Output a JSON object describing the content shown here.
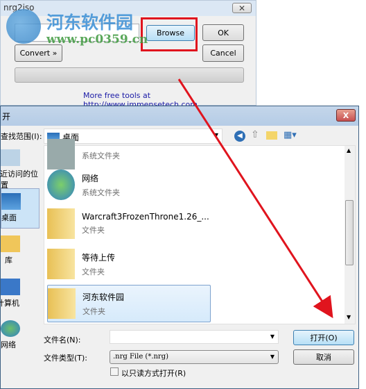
{
  "app": {
    "title": "nrg2iso",
    "browse": "Browse",
    "ok": "OK",
    "convert": "Convert »",
    "cancel": "Cancel",
    "progress": 0,
    "link": "More free tools at http://www.immensetech.com"
  },
  "watermark": {
    "name": "河东软件园",
    "url": "www.pc0359.cn"
  },
  "dialog": {
    "title": "开",
    "close": "X",
    "look_in_label": "查找范围(I):",
    "look_in_value": "桌面",
    "sidebar": [
      {
        "label": "最近访问的位置"
      },
      {
        "label": "桌面"
      },
      {
        "label": "库"
      },
      {
        "label": "计算机"
      },
      {
        "label": "网络"
      }
    ],
    "items": [
      {
        "name": "",
        "type": "系统文件夹",
        "icon": "computer-icon"
      },
      {
        "name": "网络",
        "type": "系统文件夹",
        "icon": "network-icon"
      },
      {
        "name": "Warcraft3FrozenThrone1.26_...",
        "type": "文件夹",
        "icon": "folder-icon"
      },
      {
        "name": "等待上传",
        "type": "文件夹",
        "icon": "folder-icon"
      },
      {
        "name": "河东软件园",
        "type": "文件夹",
        "icon": "folder-icon",
        "selected": true
      }
    ],
    "filename_label": "文件名(N):",
    "filename_value": "",
    "filetype_label": "文件类型(T):",
    "filetype_value": ".nrg File (*.nrg)",
    "readonly_label": "以只读方式打开(R)",
    "open": "打开(O)",
    "cancel": "取消"
  },
  "annotation_color": "#e0141e"
}
